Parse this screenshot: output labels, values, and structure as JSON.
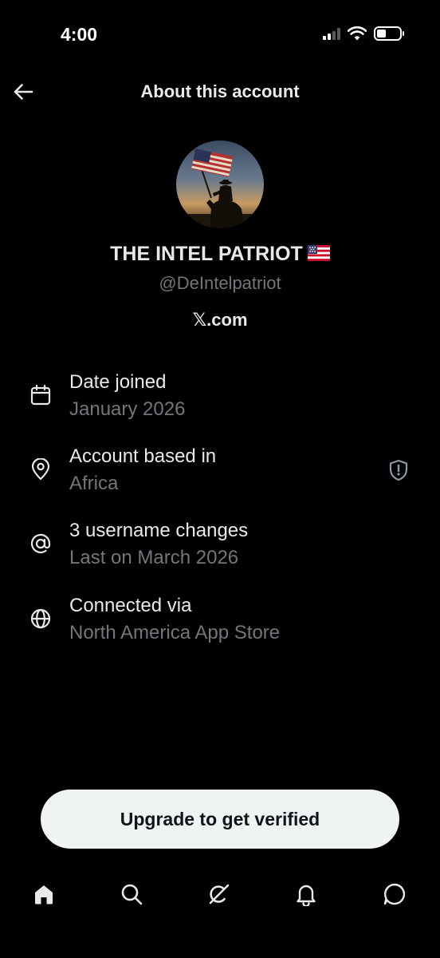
{
  "status_bar": {
    "time": "4:00",
    "icons": [
      "cellular-signal-icon",
      "wifi-icon",
      "battery-icon"
    ]
  },
  "header": {
    "back_icon": "arrow-left-icon",
    "title": "About this account"
  },
  "profile": {
    "avatar": "silhouette of rider holding american flag at dusk",
    "display_name": "THE INTEL PATRIOT",
    "name_emoji": "us-flag-emoji",
    "handle": "@DeIntelpatriot",
    "site": "𝕏.com"
  },
  "details": [
    {
      "icon": "calendar-icon",
      "label": "Date joined",
      "value": "January 2026"
    },
    {
      "icon": "location-pin-icon",
      "label": "Account based in",
      "value": "Africa",
      "extra_icon": "shield-alert-icon"
    },
    {
      "icon": "at-sign-icon",
      "label": "3 username changes",
      "value": "Last on March 2026"
    },
    {
      "icon": "globe-icon",
      "label": "Connected via",
      "value": "North America App Store"
    }
  ],
  "upgrade": {
    "label": "Upgrade to get verified"
  },
  "bottom_nav": [
    {
      "icon": "home-icon",
      "active": true
    },
    {
      "icon": "search-icon"
    },
    {
      "icon": "grok-icon"
    },
    {
      "icon": "bell-icon"
    },
    {
      "icon": "messages-icon"
    }
  ],
  "colors": {
    "background": "#000000",
    "primary_text": "#e7e9ea",
    "secondary_text": "#71767b",
    "button_bg": "#eff3f4",
    "button_text": "#0f1419"
  }
}
